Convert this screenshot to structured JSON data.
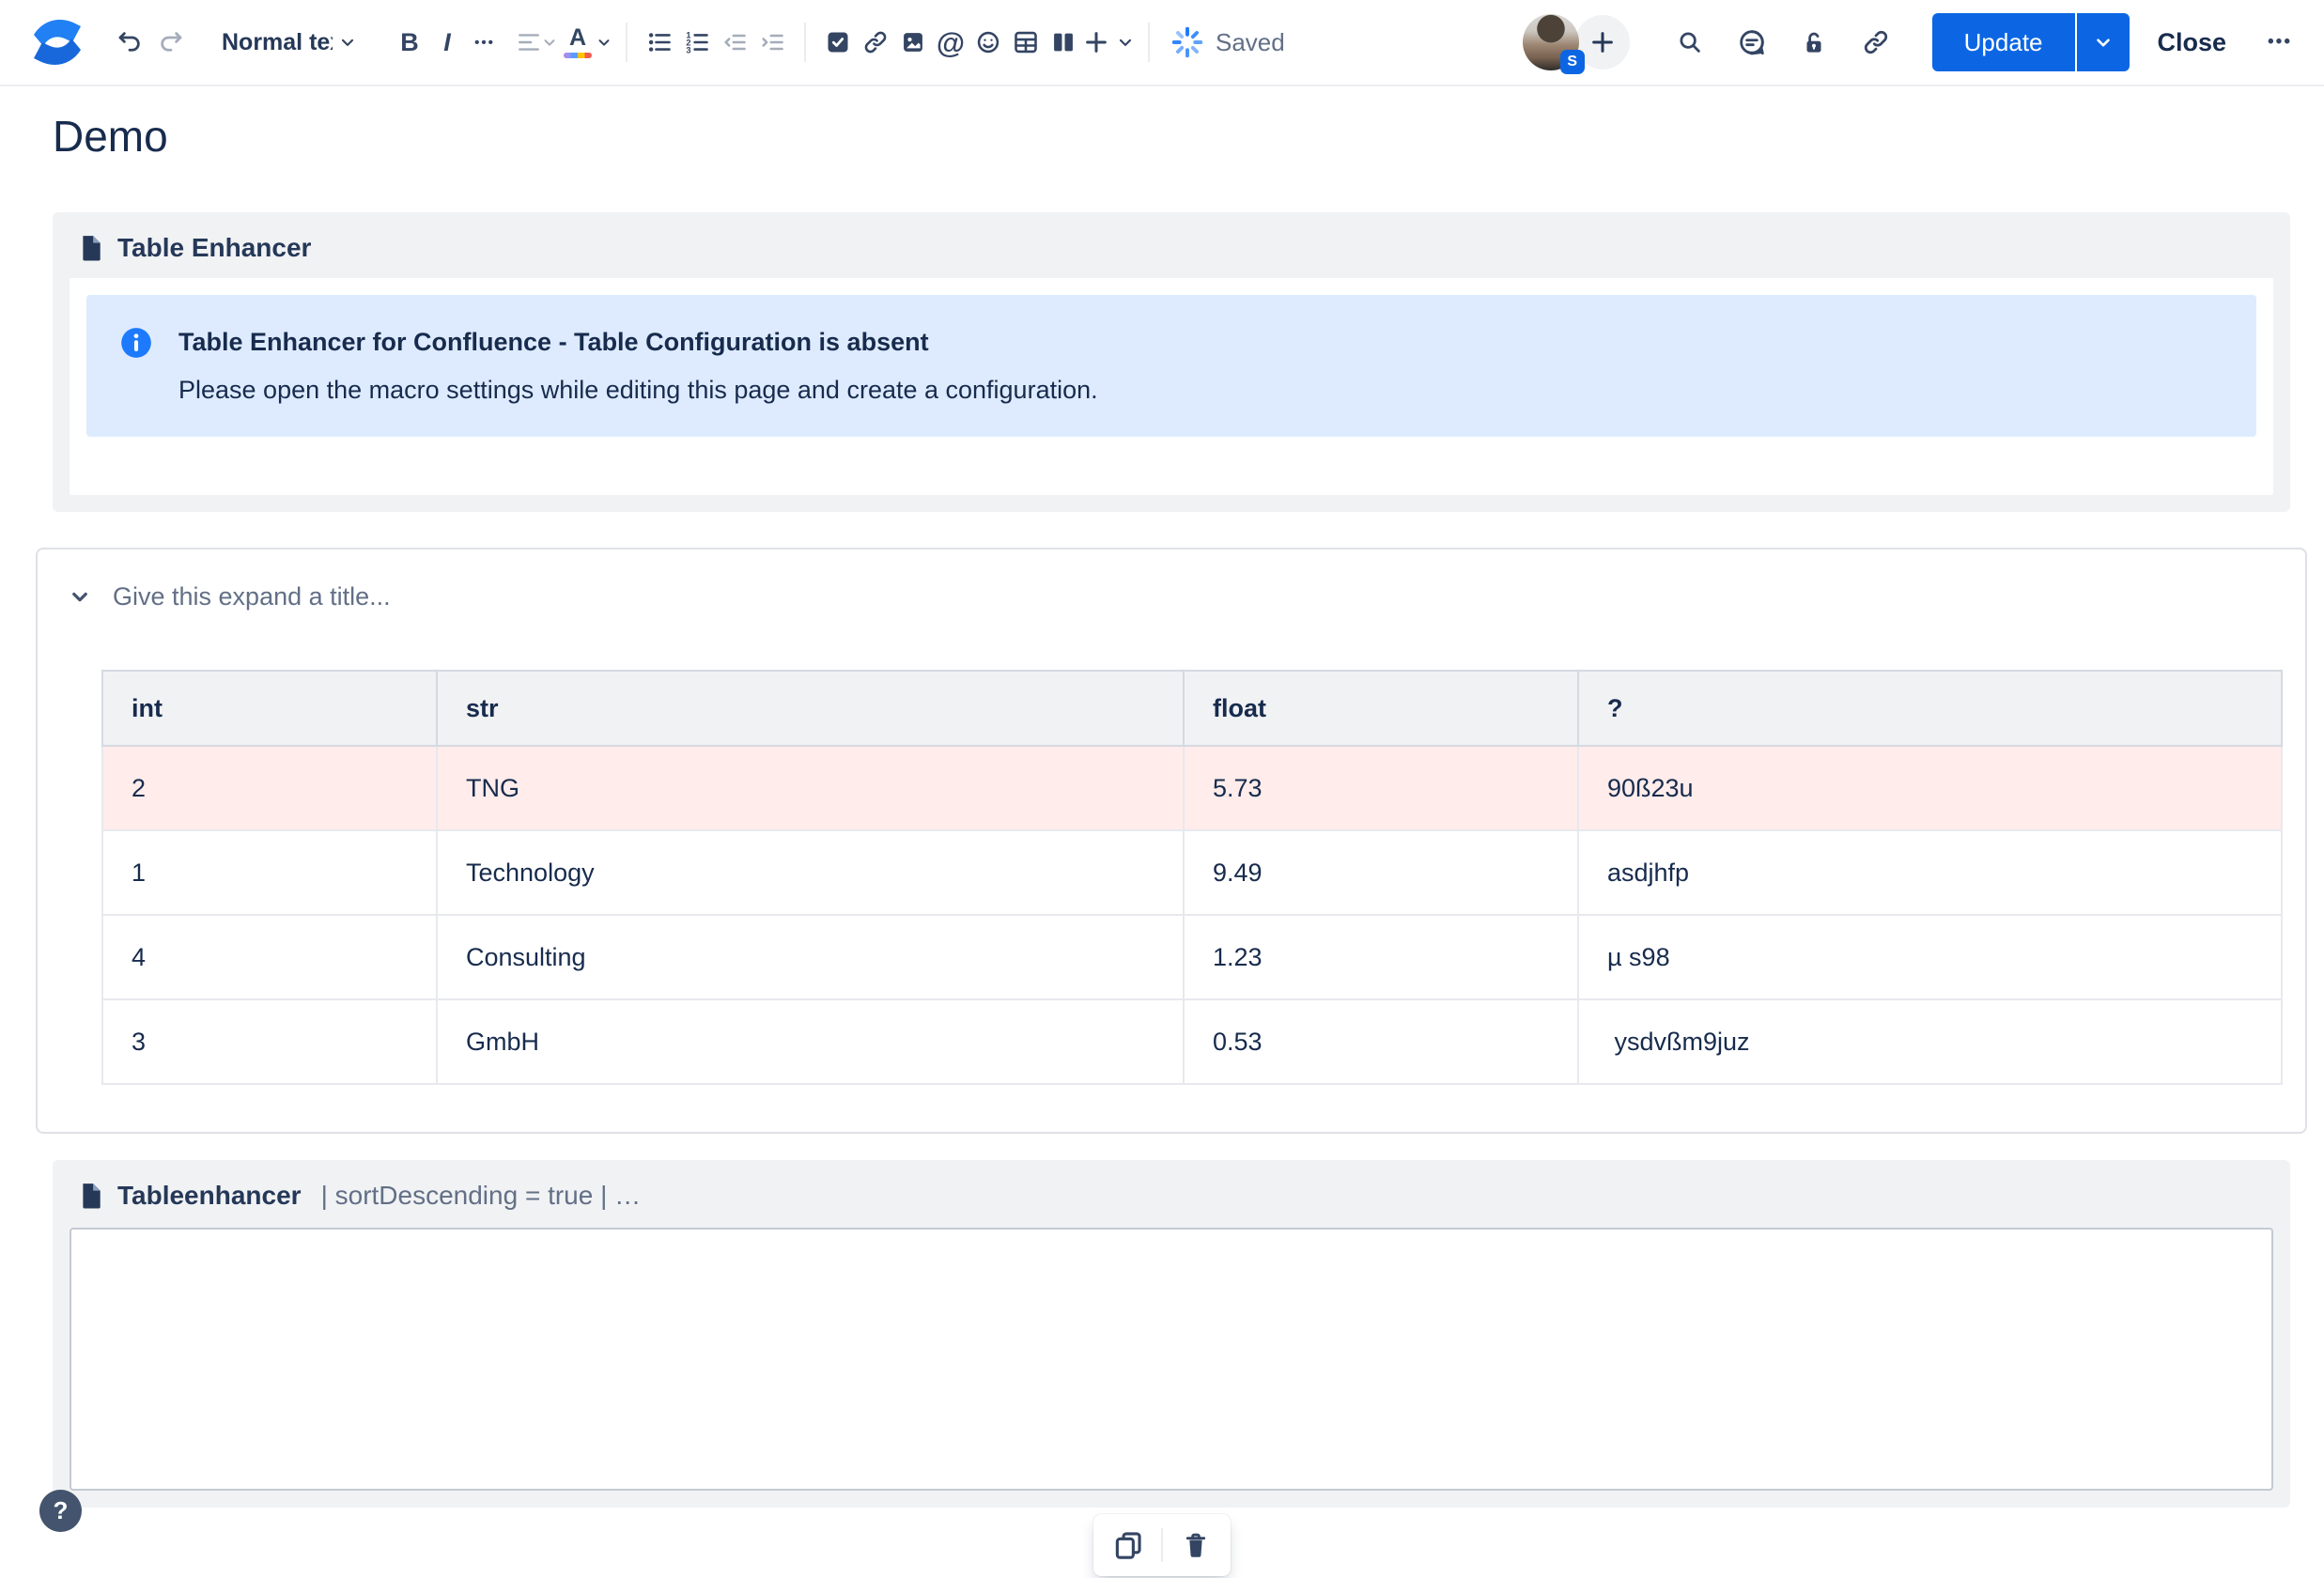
{
  "toolbar": {
    "style_dropdown_label": "Normal text",
    "bold_label": "B",
    "italic_label": "I",
    "more_formatting_label": "•••",
    "mention_glyph": "@",
    "saved_label": "Saved",
    "avatar_badge": "S",
    "update_label": "Update",
    "close_label": "Close",
    "more_actions_label": "•••",
    "icons": {
      "confluence-logo": "two blue swooshes",
      "undo-icon": "curved arrow left",
      "redo-icon": "curved arrow right (disabled)",
      "align-icon": "text align lines (disabled)",
      "text-color-icon": "A with rainbow underline",
      "bullet-list-icon": "dots with lines",
      "numbered-list-icon": "numbers with lines",
      "outdent-icon": "disabled",
      "indent-icon": "disabled",
      "task-icon": "checked box",
      "link-icon": "chain",
      "image-icon": "picture",
      "emoji-icon": "smiley",
      "table-icon": "grid",
      "layout-icon": "two columns",
      "insert-plus-icon": "+",
      "sync-spinner-icon": "blue burst",
      "search-icon": "magnifier",
      "comment-icon": "speech bubble",
      "unlock-icon": "open padlock",
      "copy-link-icon": "chain"
    }
  },
  "page": {
    "title": "Demo"
  },
  "macro_table_enhancer": {
    "title": "Table Enhancer",
    "info": {
      "heading": "Table Enhancer for Confluence - Table Configuration is absent",
      "body": "Please open the macro settings while editing this page and create a configuration."
    }
  },
  "expand": {
    "title_placeholder": "Give this expand a title...",
    "table": {
      "headers": [
        "int",
        "str",
        "float",
        "?"
      ],
      "rows": [
        {
          "cells": [
            "2",
            "TNG",
            "5.73",
            "90ß23u"
          ],
          "highlight": true
        },
        {
          "cells": [
            "1",
            "Technology",
            "9.49",
            "asdjhfp"
          ],
          "highlight": false
        },
        {
          "cells": [
            "4",
            "Consulting",
            "1.23",
            "µ s98"
          ],
          "highlight": false
        },
        {
          "cells": [
            "3",
            "GmbH",
            "0.53",
            " ysdvßm9juz"
          ],
          "highlight": false
        }
      ]
    }
  },
  "macro_tableenhancer": {
    "title": "Tableenhancer",
    "params": "| sortDescending = true | …"
  },
  "footer": {
    "help_label": "?"
  },
  "colors": {
    "accent_blue": "#0c66e4",
    "info_panel_bg": "#deebff",
    "info_icon_blue": "#1d7afc",
    "highlight_row_pink": "#ffeceb",
    "macro_bg": "#f1f2f4",
    "text": "#172b4d",
    "muted_text": "#626f86"
  }
}
